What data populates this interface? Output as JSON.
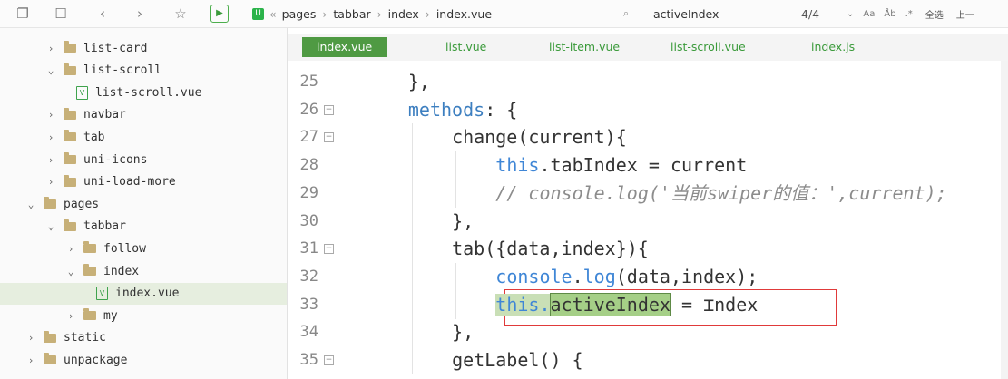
{
  "toolbar": {
    "icons": [
      "new-file-icon",
      "save-icon",
      "back-icon",
      "forward-icon",
      "star-icon",
      "run-icon"
    ],
    "breadcrumb": [
      "pages",
      "tabbar",
      "index",
      "index.vue"
    ],
    "find": {
      "value": "activeIndex",
      "count": "4/4",
      "opt_case": "Aa",
      "opt_word": "Åb",
      "select_all": "全选",
      "prev": "上一"
    }
  },
  "sidebar": {
    "rows": [
      {
        "label": "list-card",
        "type": "folder",
        "expanded": false,
        "indent": 2
      },
      {
        "label": "list-scroll",
        "type": "folder",
        "expanded": true,
        "indent": 2
      },
      {
        "label": "list-scroll.vue",
        "type": "vue",
        "expanded": null,
        "indent": 3
      },
      {
        "label": "navbar",
        "type": "folder",
        "expanded": false,
        "indent": 2
      },
      {
        "label": "tab",
        "type": "folder",
        "expanded": false,
        "indent": 2
      },
      {
        "label": "uni-icons",
        "type": "folder",
        "expanded": false,
        "indent": 2
      },
      {
        "label": "uni-load-more",
        "type": "folder",
        "expanded": false,
        "indent": 2
      },
      {
        "label": "pages",
        "type": "folder",
        "expanded": true,
        "indent": 1
      },
      {
        "label": "tabbar",
        "type": "folder",
        "expanded": true,
        "indent": 2
      },
      {
        "label": "follow",
        "type": "folder",
        "expanded": false,
        "indent": 3
      },
      {
        "label": "index",
        "type": "folder",
        "expanded": true,
        "indent": 3
      },
      {
        "label": "index.vue",
        "type": "vue",
        "expanded": null,
        "indent": 4,
        "selected": true
      },
      {
        "label": "my",
        "type": "folder",
        "expanded": false,
        "indent": 3
      },
      {
        "label": "static",
        "type": "folder",
        "expanded": false,
        "indent": 1
      },
      {
        "label": "unpackage",
        "type": "folder",
        "expanded": false,
        "indent": 1
      }
    ]
  },
  "tabs": [
    "index.vue",
    "list.vue",
    "list-item.vue",
    "list-scroll.vue",
    "index.js"
  ],
  "editor": {
    "lines": [
      {
        "num": "25",
        "fold": false,
        "indent": 1,
        "code": "},"
      },
      {
        "num": "26",
        "fold": true,
        "indent": 1,
        "code": "methods: {"
      },
      {
        "num": "27",
        "fold": true,
        "indent": 2,
        "code": "change(current){"
      },
      {
        "num": "28",
        "fold": false,
        "indent": 3,
        "code": "this.tabIndex = current"
      },
      {
        "num": "29",
        "fold": false,
        "indent": 3,
        "code": "// console.log('当前swiper的值：',current);"
      },
      {
        "num": "30",
        "fold": false,
        "indent": 2,
        "code": "},"
      },
      {
        "num": "31",
        "fold": true,
        "indent": 2,
        "code": "tab({data,index}){"
      },
      {
        "num": "32",
        "fold": false,
        "indent": 3,
        "code": "console.log(data,index);"
      },
      {
        "num": "33",
        "fold": false,
        "indent": 3,
        "code": "this.activeIndex = index"
      },
      {
        "num": "34",
        "fold": false,
        "indent": 2,
        "code": "},"
      },
      {
        "num": "35",
        "fold": true,
        "indent": 2,
        "code": "getLabel() {"
      }
    ]
  },
  "colors": {
    "accent": "#4f9a43",
    "highlight_box": "#e03a3a"
  }
}
